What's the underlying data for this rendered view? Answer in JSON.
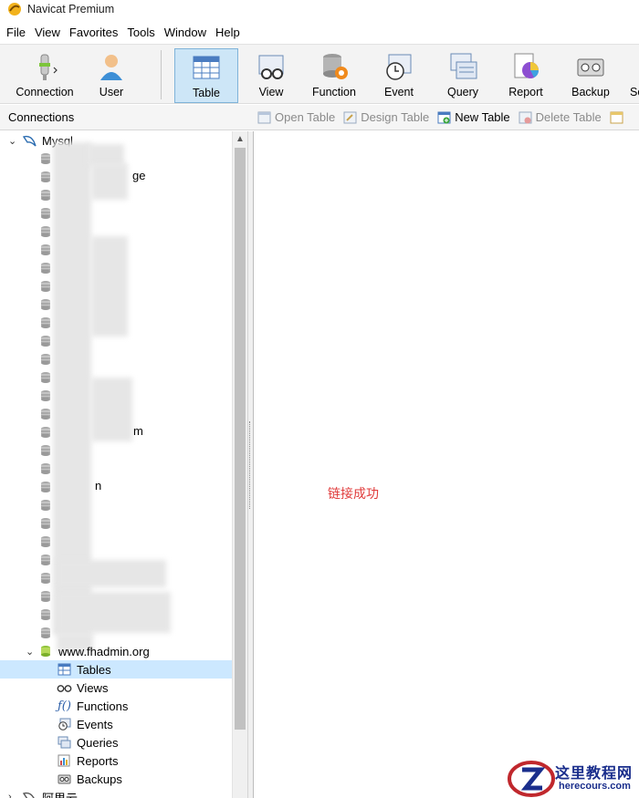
{
  "window": {
    "title": "Navicat Premium"
  },
  "menu": [
    "File",
    "View",
    "Favorites",
    "Tools",
    "Window",
    "Help"
  ],
  "toolbar": {
    "connection": "Connection",
    "user": "User",
    "table": "Table",
    "view": "View",
    "function": "Function",
    "event": "Event",
    "query": "Query",
    "report": "Report",
    "backup": "Backup",
    "schedule_partial": "So"
  },
  "connections_header": "Connections",
  "object_toolbar": {
    "open_table": "Open Table",
    "design_table": "Design Table",
    "new_table": "New Table",
    "delete_table": "Delete Table"
  },
  "tree": {
    "mysql_connection": "Mysql",
    "visible_fragments": [
      "ge",
      "m",
      "n"
    ],
    "database": "www.fhadmin.org",
    "children": [
      "Tables",
      "Views",
      "Functions",
      "Events",
      "Queries",
      "Reports",
      "Backups"
    ],
    "next_connection": "阿里云"
  },
  "main": {
    "status_message": "链接成功"
  },
  "watermark": {
    "cn": "这里教程网",
    "en": "herecours.com"
  },
  "colors": {
    "selection": "#cce8ff",
    "status": "#e03b3b",
    "active_tool": "#cde6f7"
  }
}
